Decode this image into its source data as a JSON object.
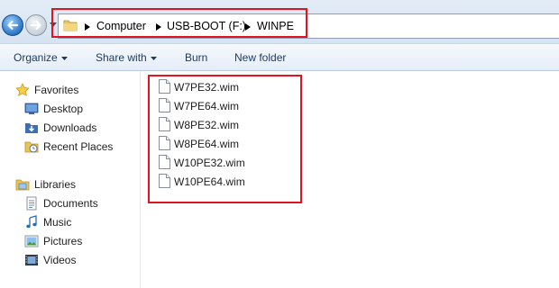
{
  "address_bar": {
    "breadcrumbs": [
      "Computer",
      "USB-BOOT (F:)",
      "WINPE"
    ]
  },
  "toolbar": {
    "organize": "Organize",
    "share_with": "Share with",
    "burn": "Burn",
    "new_folder": "New folder"
  },
  "nav_pane": {
    "favorites": {
      "label": "Favorites",
      "items": [
        "Desktop",
        "Downloads",
        "Recent Places"
      ]
    },
    "libraries": {
      "label": "Libraries",
      "items": [
        "Documents",
        "Music",
        "Pictures",
        "Videos"
      ]
    }
  },
  "files": [
    "W7PE32.wim",
    "W7PE64.wim",
    "W8PE32.wim",
    "W8PE64.wim",
    "W10PE32.wim",
    "W10PE64.wim"
  ],
  "colors": {
    "highlight": "#e0141e",
    "toolbar_text": "#1e395b",
    "back_button": "#2a74c7"
  }
}
